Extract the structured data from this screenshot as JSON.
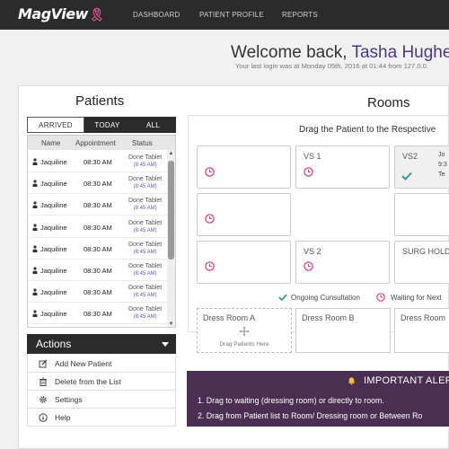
{
  "nav": {
    "logo": "MagView",
    "items": [
      "DASHBOARD",
      "PATIENT PROFILE",
      "REPORTS"
    ]
  },
  "header": {
    "welcome_prefix": "Welcome back, ",
    "user_name": "Tasha Hughe",
    "last_login": "Your last login was at Monday 05th, 2016 at 01:44 from 127.0.0."
  },
  "patients": {
    "title": "Patients",
    "tabs": [
      "ARRIVED",
      "TODAY",
      "ALL"
    ],
    "active_tab": "ARRIVED",
    "columns": [
      "Name",
      "Appointment",
      "Status"
    ],
    "rows": [
      {
        "name": "Jaquiline",
        "time": "08:30 AM",
        "status": "Done Tablet",
        "status_time": "(8:45 AM)"
      },
      {
        "name": "Jaquiline",
        "time": "08:30 AM",
        "status": "Done Tablet",
        "status_time": "(8:45 AM)"
      },
      {
        "name": "Jaquiline",
        "time": "08:30 AM",
        "status": "Done Tablet",
        "status_time": "(8:45 AM)"
      },
      {
        "name": "Jaquiline",
        "time": "08:30 AM",
        "status": "Done Tablet",
        "status_time": "(8:45 AM)"
      },
      {
        "name": "Jaquiline",
        "time": "08:30 AM",
        "status": "Done Tablet",
        "status_time": "(8:45 AM)"
      },
      {
        "name": "Jaquiline",
        "time": "08:30 AM",
        "status": "Done Tablet",
        "status_time": "(8:45 AM)"
      },
      {
        "name": "Jaquiline",
        "time": "08:30 AM",
        "status": "Done Tablet",
        "status_time": "(8:45 AM)"
      },
      {
        "name": "Jaquiline",
        "time": "08:30 AM",
        "status": "Done Tablet",
        "status_time": "(8:45 AM)"
      }
    ]
  },
  "actions": {
    "title": "Actions",
    "items": [
      {
        "label": "Add New Patient",
        "icon": "edit-icon"
      },
      {
        "label": "Delete from the List",
        "icon": "trash-icon"
      },
      {
        "label": "Settings",
        "icon": "gear-icon"
      },
      {
        "label": "Help",
        "icon": "info-icon"
      }
    ]
  },
  "rooms": {
    "title": "Rooms",
    "instruction": "Drag the Patient to the Respective",
    "vs1": "VS 1",
    "vs2": "VS2",
    "vs2_occupant_line1": "Jo",
    "vs2_occupant_line2": "9:3",
    "vs2_occupant_line3": "Te",
    "vs2b": "VS 2",
    "surg_hold": "SURG HOLD",
    "legend_ongoing": "Ongoing Cunsultation",
    "legend_waiting": "Waiting for Next",
    "dress_rooms": [
      "Dress Room A",
      "Dress Room B",
      "Dress Room"
    ],
    "drag_hint": "Drag Patients Here"
  },
  "alert": {
    "title": "IMPORTANT ALERT",
    "lines": [
      "1.  Drag to waiting (dressing room) or directly to room.",
      "2.  Drag from Patient list to Room/ Dressing room or Between Ro"
    ]
  },
  "colors": {
    "nav_bg": "#2b2b2b",
    "accent_purple": "#4a3a7a",
    "alert_bg": "#4a2f52",
    "clock_pink": "#e0457a",
    "check_teal": "#3a9a8a"
  }
}
